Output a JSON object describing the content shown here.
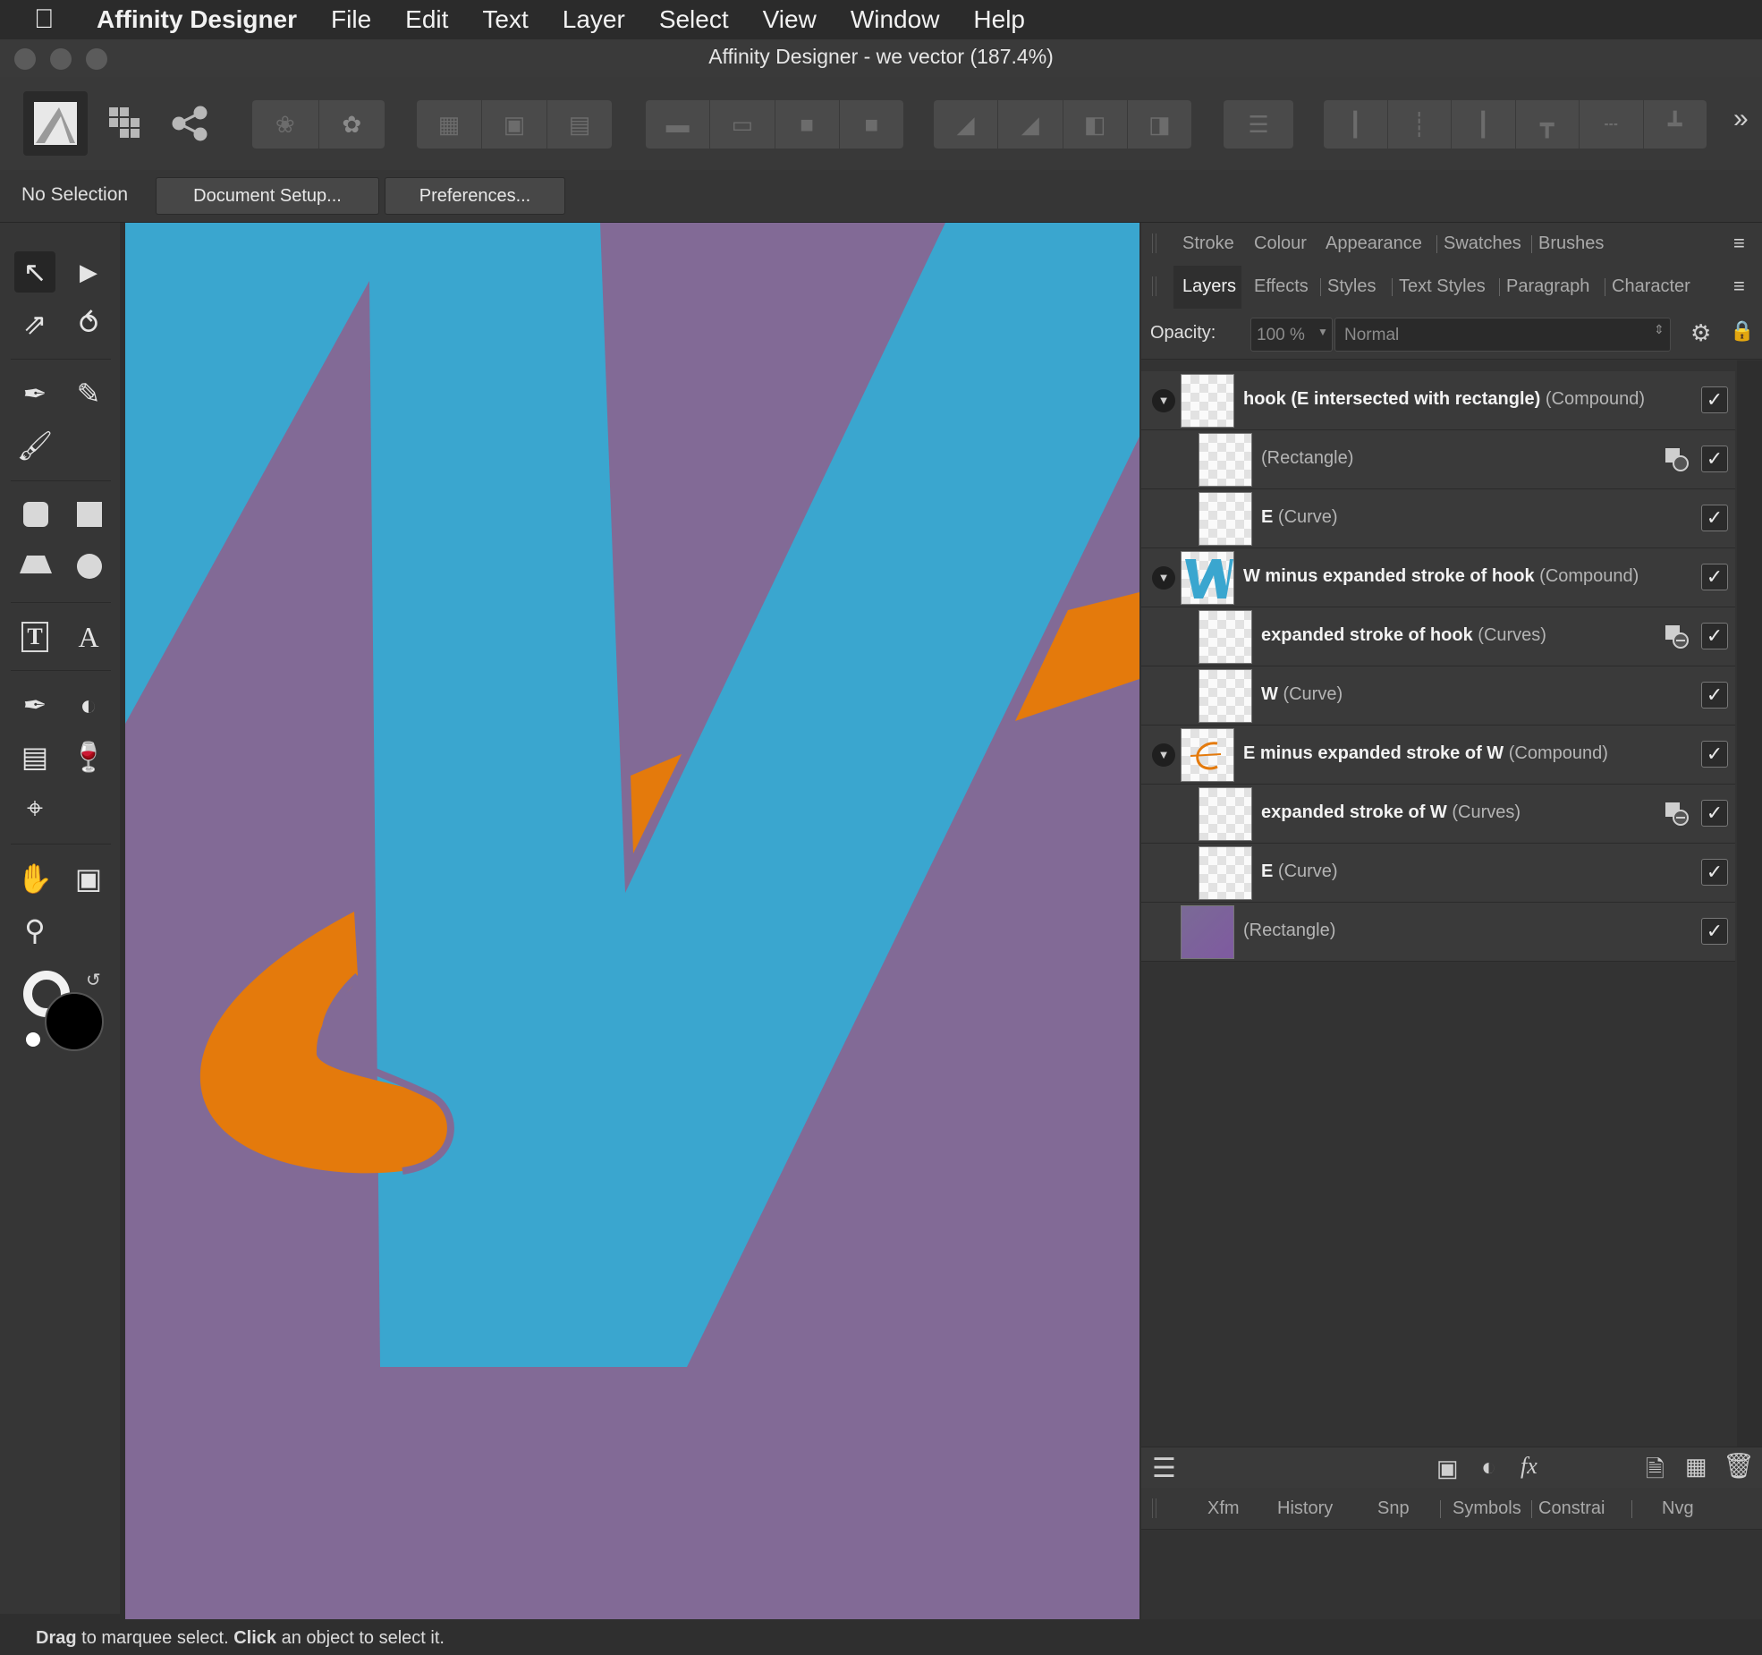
{
  "menubar": {
    "app_name": "Affinity Designer",
    "items": [
      "File",
      "Edit",
      "Text",
      "Layer",
      "Select",
      "View",
      "Window",
      "Help"
    ]
  },
  "window": {
    "title": "Affinity Designer - we vector (187.4%)"
  },
  "context": {
    "selection_label": "No Selection",
    "document_setup": "Document Setup...",
    "preferences": "Preferences..."
  },
  "panel_tabs_top": [
    "Stroke",
    "Colour",
    "Appearance",
    "Swatches",
    "Brushes"
  ],
  "panel_tabs_second": [
    "Layers",
    "Effects",
    "Styles",
    "Text Styles",
    "Paragraph",
    "Character"
  ],
  "layers_panel": {
    "opacity_label": "Opacity:",
    "opacity_value": "100 %",
    "blend_mode": "Normal",
    "layers": [
      {
        "name": "hook (E intersected with rectangle)",
        "type": "(Compound)"
      },
      {
        "name": "",
        "type": "(Rectangle)"
      },
      {
        "name": "E",
        "type": "(Curve)"
      },
      {
        "name": "W minus expanded stroke of hook",
        "type": "(Compound)"
      },
      {
        "name": "expanded stroke of hook",
        "type": "(Curves)"
      },
      {
        "name": "W",
        "type": "(Curve)"
      },
      {
        "name": "E minus expanded stroke of W",
        "type": "(Compound)"
      },
      {
        "name": "expanded stroke of W",
        "type": "(Curves)"
      },
      {
        "name": "E",
        "type": "(Curve)"
      },
      {
        "name": "",
        "type": "(Rectangle)"
      }
    ]
  },
  "bottom_tabs": [
    "Xfm",
    "History",
    "Snp",
    "Symbols",
    "Constrai",
    "Nvg"
  ],
  "status": {
    "drag": "Drag",
    "drag_rest": " to marquee select. ",
    "click": "Click",
    "click_rest": " an object to select it."
  },
  "colors": {
    "canvas_purple": "#826a96",
    "shape_blue": "#3aa6cf",
    "shape_orange": "#e47a0c"
  }
}
